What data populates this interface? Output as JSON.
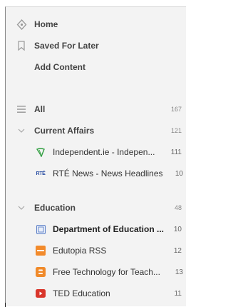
{
  "nav": {
    "home": "Home",
    "saved": "Saved For Later",
    "add": "Add Content"
  },
  "all": {
    "label": "All",
    "count": "167"
  },
  "categories": [
    {
      "label": "Current Affairs",
      "count": "121",
      "feeds": [
        {
          "label": "Independent.ie - Indepen...",
          "count": "111"
        },
        {
          "label": "RTÉ News - News Headlines",
          "count": "10"
        }
      ]
    },
    {
      "label": "Education",
      "count": "48",
      "feeds": [
        {
          "label": "Department of Education ...",
          "count": "10"
        },
        {
          "label": "Edutopia RSS",
          "count": "12"
        },
        {
          "label": "Free Technology for Teach...",
          "count": "13"
        },
        {
          "label": "TED Education",
          "count": "11"
        }
      ]
    }
  ],
  "icons": {
    "rte_text": "RTÉ",
    "accent_edutopia": "#f28a2b",
    "accent_ftt": "#f08a2a",
    "accent_ted": "#d9362b",
    "accent_doe": "#5c7fc6",
    "accent_indep": "#2f9e3f"
  }
}
